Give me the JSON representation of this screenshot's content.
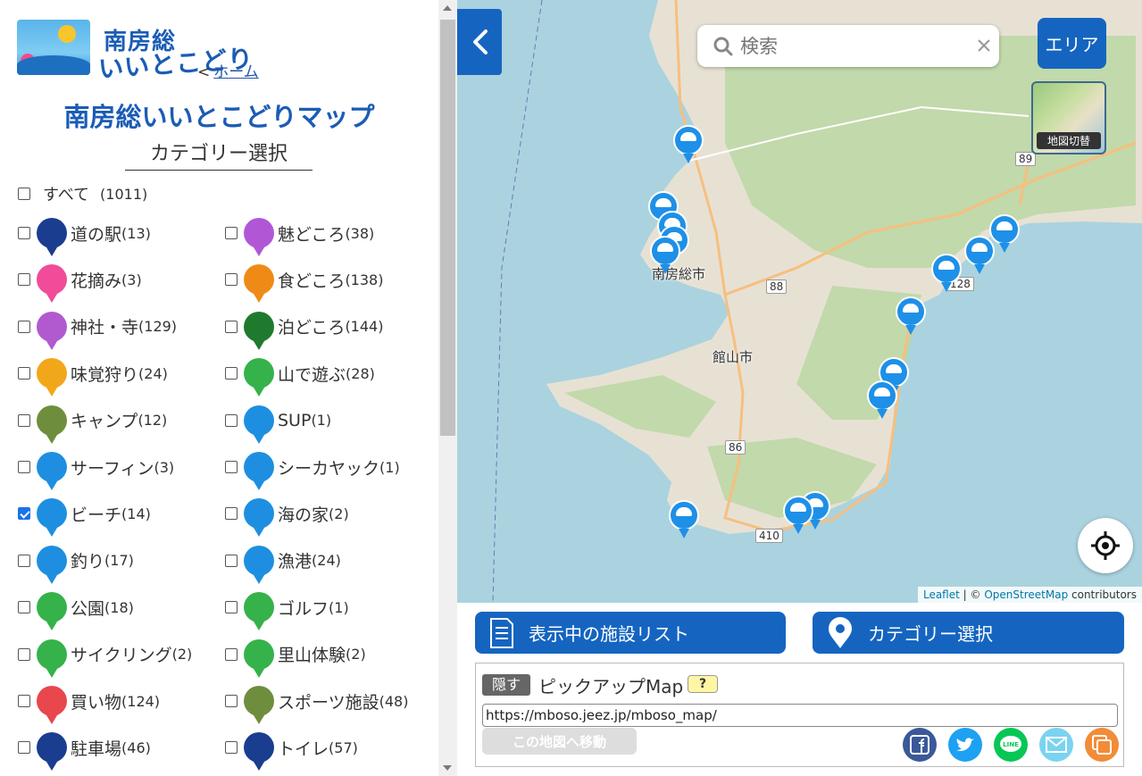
{
  "sidebar": {
    "logo_title": "南房総",
    "logo_subtitle": "いいとこどり",
    "home_prefix": "<",
    "home_link": "ホーム",
    "map_title": "南房総いいとこどりマップ",
    "category_heading": "カテゴリー選択",
    "all": {
      "label": "すべて",
      "count": "(1011)",
      "checked": false
    },
    "categories": [
      {
        "label": "道の駅",
        "count": "(13)",
        "color": "#1a3d8f",
        "icon": "roadside-station-icon",
        "checked": false
      },
      {
        "label": "魅どころ",
        "count": "(38)",
        "color": "#b157d6",
        "icon": "eye-icon",
        "checked": false
      },
      {
        "label": "花摘み",
        "count": "(3)",
        "color": "#f04c9a",
        "icon": "flower-icon",
        "checked": false
      },
      {
        "label": "食どころ",
        "count": "(138)",
        "color": "#f08a17",
        "icon": "fork-knife-icon",
        "checked": false
      },
      {
        "label": "神社・寺",
        "count": "(129)",
        "color": "#b15ad0",
        "icon": "shrine-icon",
        "checked": false
      },
      {
        "label": "泊どころ",
        "count": "(144)",
        "color": "#1f7a2e",
        "icon": "bed-icon",
        "checked": false
      },
      {
        "label": "味覚狩り",
        "count": "(24)",
        "color": "#f2a71b",
        "icon": "fruit-icon",
        "checked": false
      },
      {
        "label": "山で遊ぶ",
        "count": "(28)",
        "color": "#35b24a",
        "icon": "mountain-icon",
        "checked": false
      },
      {
        "label": "キャンプ",
        "count": "(12)",
        "color": "#6f8e3d",
        "icon": "tent-icon",
        "checked": false
      },
      {
        "label": "SUP",
        "count": "(1)",
        "color": "#1e8fe0",
        "icon": "sup-icon",
        "checked": false
      },
      {
        "label": "サーフィン",
        "count": "(3)",
        "color": "#1e8fe0",
        "icon": "surfing-icon",
        "checked": false
      },
      {
        "label": "シーカヤック",
        "count": "(1)",
        "color": "#1e8fe0",
        "icon": "kayak-icon",
        "checked": false
      },
      {
        "label": "ビーチ",
        "count": "(14)",
        "color": "#1e8fe0",
        "icon": "beach-umbrella-icon",
        "checked": true
      },
      {
        "label": "海の家",
        "count": "(2)",
        "color": "#1e8fe0",
        "icon": "beach-house-icon",
        "checked": false
      },
      {
        "label": "釣り",
        "count": "(17)",
        "color": "#1e8fe0",
        "icon": "fish-icon",
        "checked": false
      },
      {
        "label": "漁港",
        "count": "(24)",
        "color": "#1e8fe0",
        "icon": "ship-icon",
        "checked": false
      },
      {
        "label": "公園",
        "count": "(18)",
        "color": "#35b24a",
        "icon": "tree-icon",
        "checked": false
      },
      {
        "label": "ゴルフ",
        "count": "(1)",
        "color": "#35b24a",
        "icon": "golf-icon",
        "checked": false
      },
      {
        "label": "サイクリング",
        "count": "(2)",
        "color": "#35b24a",
        "icon": "bicycle-icon",
        "checked": false
      },
      {
        "label": "里山体験",
        "count": "(2)",
        "color": "#35b24a",
        "icon": "satoyama-icon",
        "checked": false
      },
      {
        "label": "買い物",
        "count": "(124)",
        "color": "#e8474e",
        "icon": "basket-icon",
        "checked": false
      },
      {
        "label": "スポーツ施設",
        "count": "(48)",
        "color": "#6f8e3d",
        "icon": "sports-icon",
        "checked": false
      },
      {
        "label": "駐車場",
        "count": "(46)",
        "color": "#1a3d8f",
        "icon": "parking-icon",
        "checked": false
      },
      {
        "label": "トイレ",
        "count": "(57)",
        "color": "#1a3d8f",
        "icon": "toilet-icon",
        "checked": false
      }
    ]
  },
  "map": {
    "search_placeholder": "検索",
    "area_button": "エリア",
    "switch_label": "地図切替",
    "city_labels": [
      "南房総市",
      "館山市"
    ],
    "road_labels": [
      "88",
      "86",
      "410",
      "128",
      "89"
    ],
    "attribution_leaflet": "Leaflet",
    "attribution_sep": "| ©",
    "attribution_osm": "OpenStreetMap",
    "attribution_contrib": "contributors"
  },
  "bottom": {
    "list_button": "表示中の施設リスト",
    "category_button": "カテゴリー選択",
    "hide_label": "隠す",
    "pickup_title": "ピックアップMap",
    "help_label": "?",
    "url": "https://mboso.jeez.jp/mboso_map/",
    "move_button": "この地図へ移動"
  },
  "colors": {
    "primary": "#1565c0",
    "beach_pin": "#1e90e8"
  }
}
